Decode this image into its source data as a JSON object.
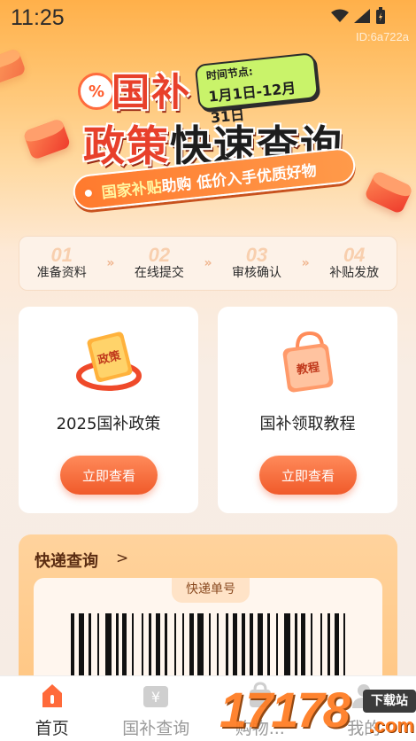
{
  "status_bar": {
    "time": "11:25",
    "id_text": "ID:6a722a"
  },
  "banner": {
    "title_line1": "国补",
    "title_line2_accent": "政策",
    "title_line2_main": "快速查询",
    "date_label": "时间节点:",
    "date_value": "1月1日-12月31日",
    "slogan_highlight": "国家补贴",
    "slogan_text": "助购 低价入手优质好物"
  },
  "steps": [
    {
      "num": "01",
      "label": "准备资料"
    },
    {
      "num": "02",
      "label": "在线提交"
    },
    {
      "num": "03",
      "label": "审核确认"
    },
    {
      "num": "04",
      "label": "补贴发放"
    }
  ],
  "cards": {
    "left": {
      "title": "2025国补政策",
      "icon_text": "政策",
      "button": "立即查看"
    },
    "right": {
      "title": "国补领取教程",
      "icon_text": "教程",
      "button": "立即查看"
    }
  },
  "express": {
    "title": "快递查询",
    "arrow": ">",
    "barcode_label": "快递单号"
  },
  "tabbar": [
    {
      "label": "首页",
      "icon": "home-icon",
      "active": true
    },
    {
      "label": "国补查询",
      "icon": "yuan-icon",
      "active": false
    },
    {
      "label": "购物...",
      "icon": "bag-icon",
      "active": false
    },
    {
      "label": "我的",
      "icon": "user-icon",
      "active": false
    }
  ],
  "watermark": {
    "digits": "17178",
    "download": "下载站",
    "com": ".com"
  },
  "colors": {
    "accent": "#f05a2a",
    "brand_orange": "#ff9a3c",
    "active_tab": "#ff6a3a"
  }
}
